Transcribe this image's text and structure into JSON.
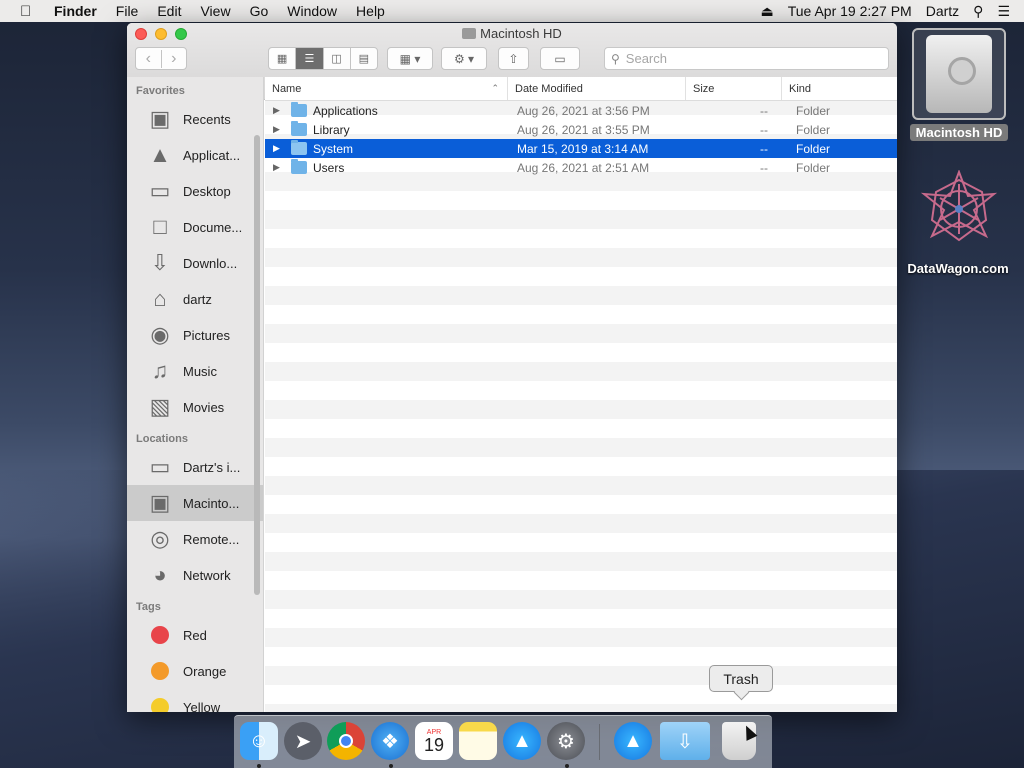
{
  "menubar": {
    "app": "Finder",
    "items": [
      "File",
      "Edit",
      "View",
      "Go",
      "Window",
      "Help"
    ],
    "clock": "Tue Apr 19  2:27 PM",
    "user": "Dartz"
  },
  "window": {
    "title": "Macintosh HD",
    "search_placeholder": "Search"
  },
  "sidebar": {
    "favorites_header": "Favorites",
    "favorites": [
      {
        "label": "Recents",
        "icon": "clock-icon"
      },
      {
        "label": "Applicat...",
        "icon": "applications-icon"
      },
      {
        "label": "Desktop",
        "icon": "desktop-icon"
      },
      {
        "label": "Docume...",
        "icon": "document-icon"
      },
      {
        "label": "Downlo...",
        "icon": "download-icon"
      },
      {
        "label": "dartz",
        "icon": "home-icon"
      },
      {
        "label": "Pictures",
        "icon": "camera-icon"
      },
      {
        "label": "Music",
        "icon": "music-icon"
      },
      {
        "label": "Movies",
        "icon": "film-icon"
      }
    ],
    "locations_header": "Locations",
    "locations": [
      {
        "label": "Dartz's i...",
        "icon": "imac-icon"
      },
      {
        "label": "Macinto...",
        "icon": "hard-disk-icon",
        "selected": true
      },
      {
        "label": "Remote...",
        "icon": "disc-icon"
      },
      {
        "label": "Network",
        "icon": "globe-icon"
      }
    ],
    "tags_header": "Tags",
    "tags": [
      {
        "label": "Red",
        "color": "#e8444a"
      },
      {
        "label": "Orange",
        "color": "#f39a2a"
      },
      {
        "label": "Yellow",
        "color": "#f4cc2a"
      }
    ]
  },
  "columns": {
    "name": "Name",
    "date": "Date Modified",
    "size": "Size",
    "kind": "Kind"
  },
  "rows": [
    {
      "name": "Applications",
      "date": "Aug 26, 2021 at 3:56 PM",
      "size": "--",
      "kind": "Folder"
    },
    {
      "name": "Library",
      "date": "Aug 26, 2021 at 3:55 PM",
      "size": "--",
      "kind": "Folder"
    },
    {
      "name": "System",
      "date": "Mar 15, 2019 at 3:14 AM",
      "size": "--",
      "kind": "Folder",
      "selected": true
    },
    {
      "name": "Users",
      "date": "Aug 26, 2021 at 2:51 AM",
      "size": "--",
      "kind": "Folder"
    }
  ],
  "desktop": {
    "hd_label": "Macintosh HD",
    "datawagon_label": "DataWagon.com"
  },
  "dock": {
    "tooltip": "Trash",
    "calendar_month": "APR",
    "calendar_day": "19",
    "apps": [
      "finder-icon",
      "launchpad-icon",
      "chrome-icon",
      "safari-icon",
      "calendar-icon",
      "notes-icon",
      "app-store-icon",
      "system-preferences-icon",
      "app-store-icon",
      "downloads-folder-icon",
      "trash-icon"
    ]
  }
}
